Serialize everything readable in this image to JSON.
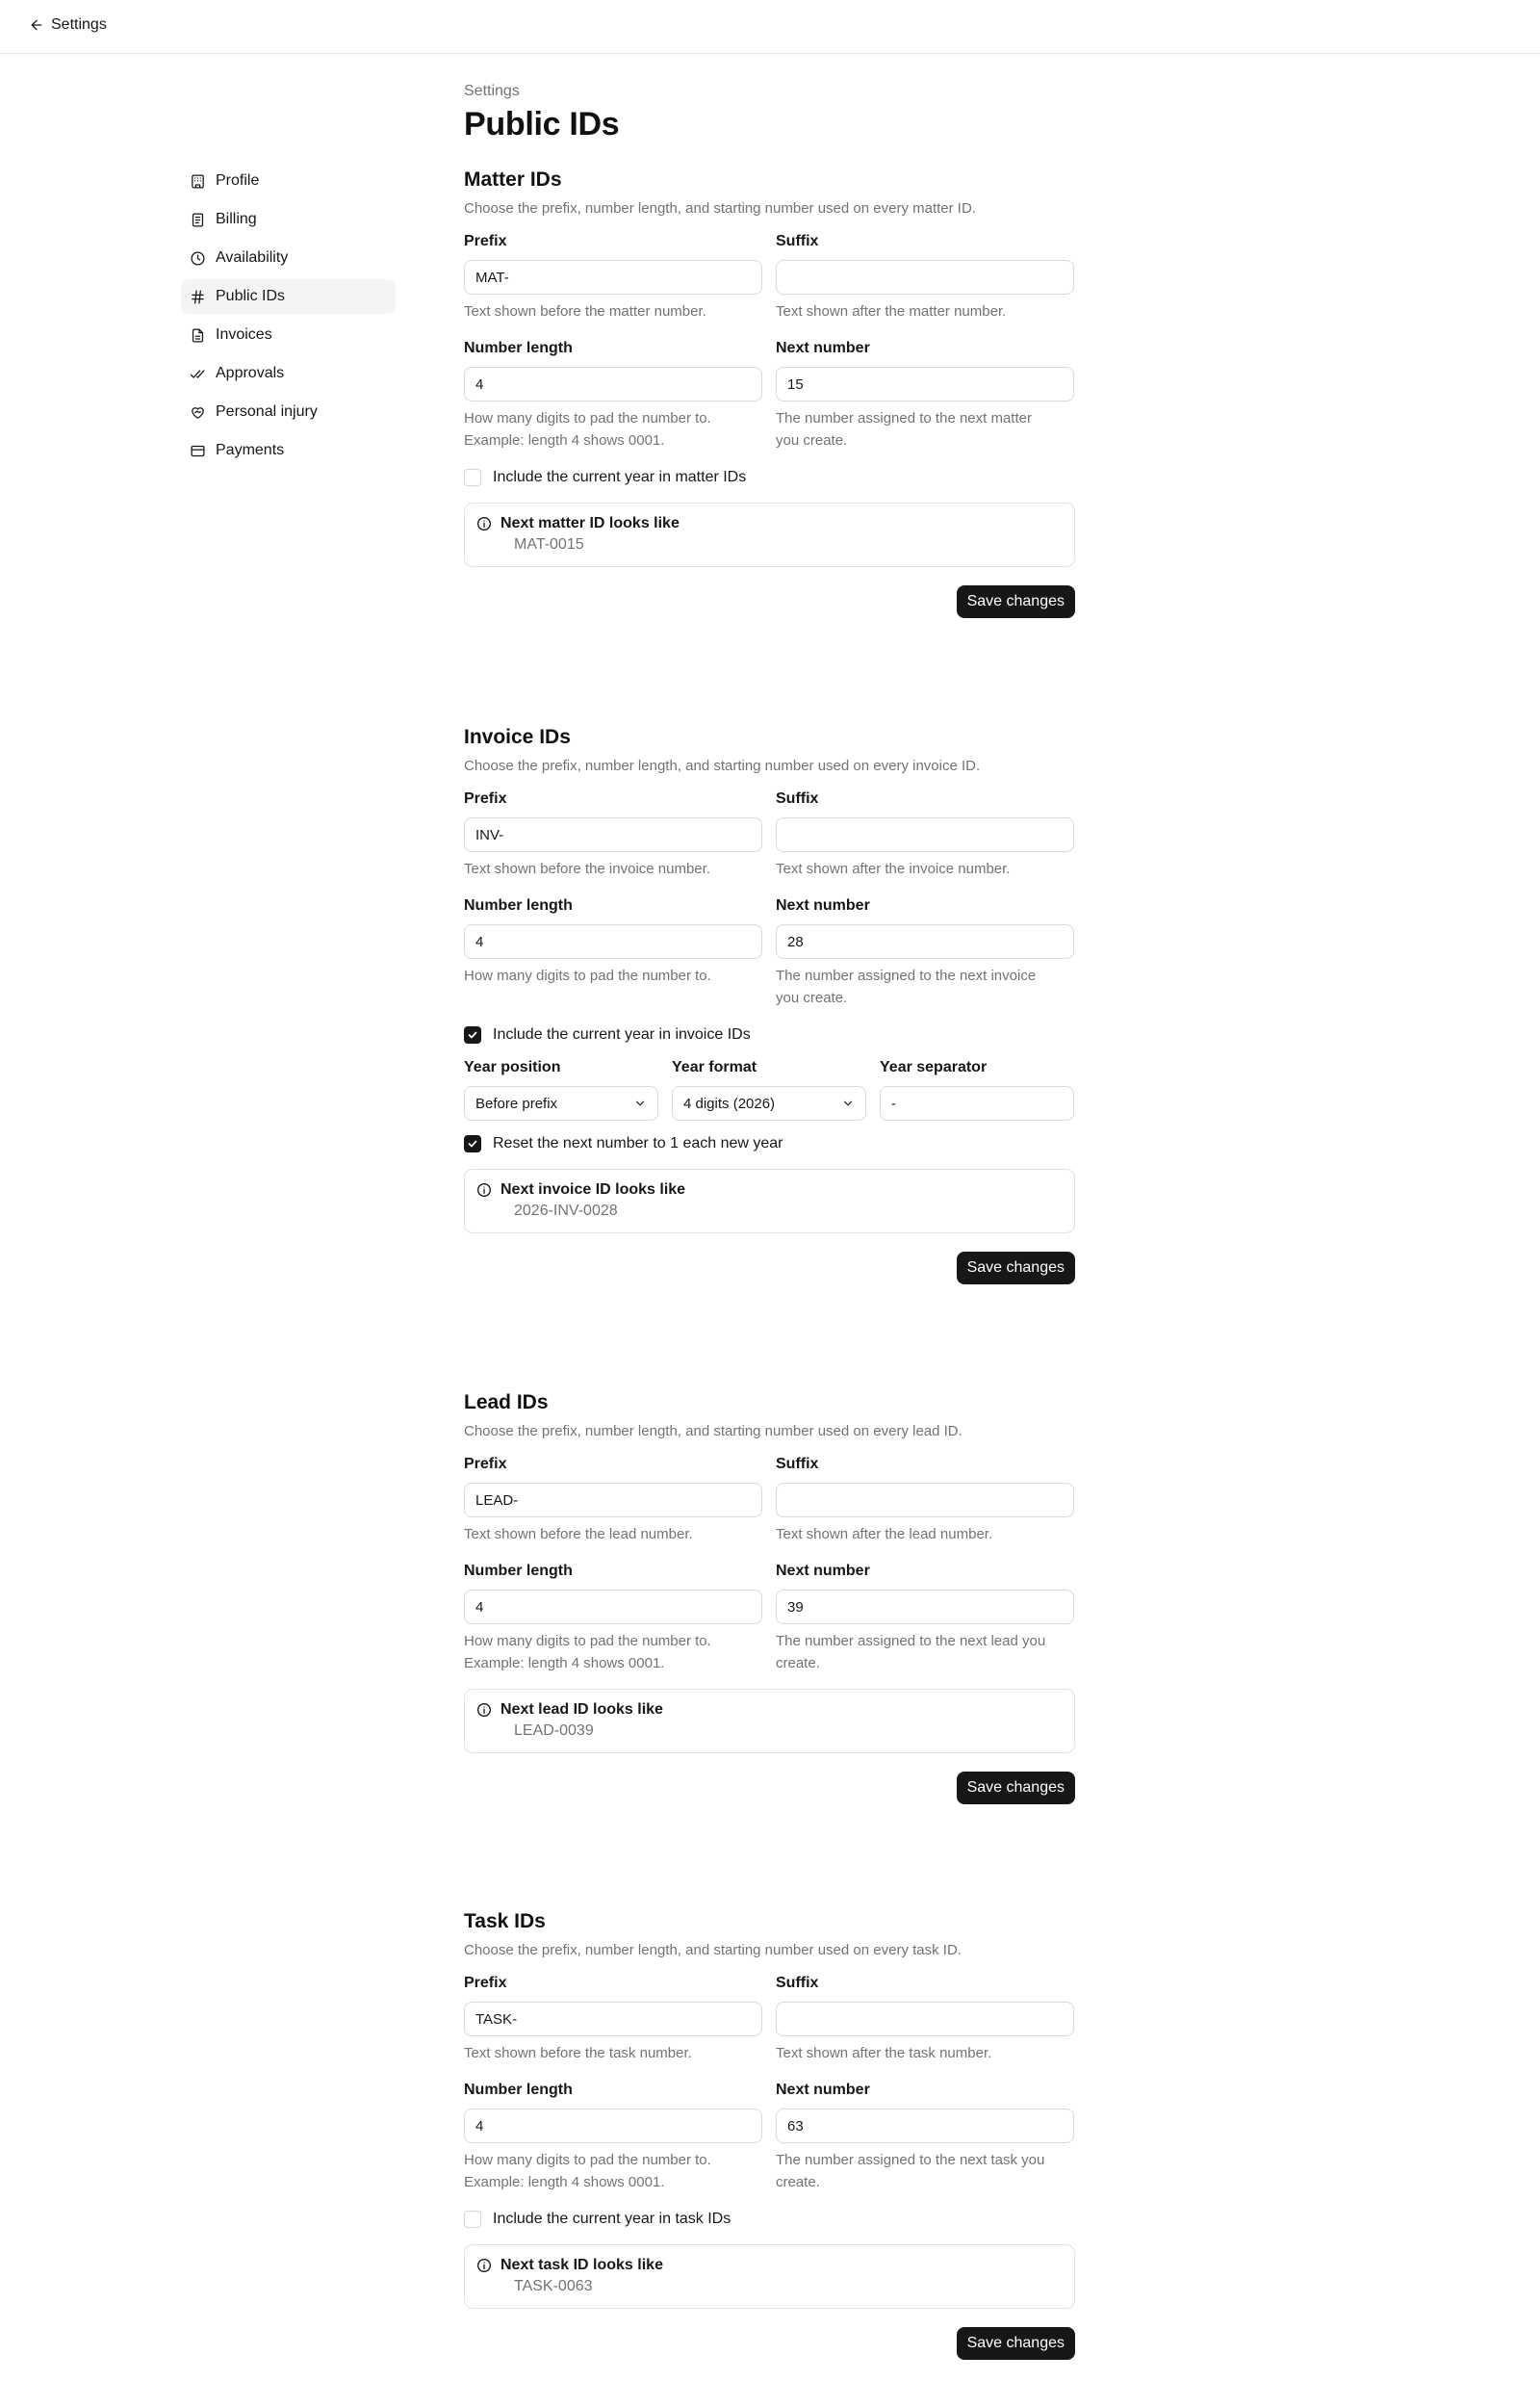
{
  "header": {
    "back_label": "Settings"
  },
  "nav": {
    "items": [
      {
        "label": "Profile",
        "icon": "building-icon"
      },
      {
        "label": "Billing",
        "icon": "receipt-icon"
      },
      {
        "label": "Availability",
        "icon": "clock-icon"
      },
      {
        "label": "Public IDs",
        "icon": "hash-icon",
        "active": true
      },
      {
        "label": "Invoices",
        "icon": "file-text-icon"
      },
      {
        "label": "Approvals",
        "icon": "check-check-icon"
      },
      {
        "label": "Personal injury",
        "icon": "heart-handshake-icon"
      },
      {
        "label": "Payments",
        "icon": "credit-card-icon"
      }
    ]
  },
  "page": {
    "breadcrumb": "Settings",
    "title": "Public IDs"
  },
  "labels": {
    "prefix": "Prefix",
    "suffix": "Suffix",
    "number_length": "Number length",
    "next_number": "Next number",
    "save": "Save changes",
    "year_position": "Year position",
    "year_format": "Year format",
    "year_separator": "Year separator"
  },
  "sections": [
    {
      "title": "Matter IDs",
      "description": "Choose the prefix, number length, and starting number used on every matter ID.",
      "prefix": "MAT-",
      "suffix": "",
      "prefix_hint": "Text shown before the matter number.",
      "suffix_hint": "Text shown after the matter number.",
      "number_length": "4",
      "next_number": "15",
      "length_hint_1": "How many digits to pad the number to.",
      "length_hint_2": "Example: length 4 shows 0001.",
      "next_hint_1": "The number assigned to the next matter",
      "next_hint_2": "you create.",
      "include_year_label": "Include the current year in matter IDs",
      "include_year": false,
      "preview_title": "Next matter ID looks like",
      "preview_value": "MAT-0015"
    },
    {
      "title": "Invoice IDs",
      "description": "Choose the prefix, number length, and starting number used on every invoice ID.",
      "prefix": "INV-",
      "suffix": "",
      "prefix_hint": "Text shown before the invoice number.",
      "suffix_hint": "Text shown after the invoice number.",
      "number_length": "4",
      "next_number": "28",
      "length_hint_1": "How many digits to pad the number to.",
      "next_hint_1": "The number assigned to the next invoice",
      "next_hint_2": "you create.",
      "include_year_label": "Include the current year in invoice IDs",
      "include_year": true,
      "year_position": "Before prefix",
      "year_format": "4 digits (2026)",
      "year_separator": "-",
      "reset_label": "Reset the next number to 1 each new year",
      "reset_yearly": true,
      "preview_title": "Next invoice ID looks like",
      "preview_value": "2026-INV-0028"
    },
    {
      "title": "Lead IDs",
      "description": "Choose the prefix, number length, and starting number used on every lead ID.",
      "prefix": "LEAD-",
      "suffix": "",
      "prefix_hint": "Text shown before the lead number.",
      "suffix_hint": "Text shown after the lead number.",
      "number_length": "4",
      "next_number": "39",
      "length_hint_1": "How many digits to pad the number to.",
      "length_hint_2": "Example: length 4 shows 0001.",
      "next_hint_1": "The number assigned to the next lead you",
      "next_hint_2": "create.",
      "preview_title": "Next lead ID looks like",
      "preview_value": "LEAD-0039"
    },
    {
      "title": "Task IDs",
      "description": "Choose the prefix, number length, and starting number used on every task ID.",
      "prefix": "TASK-",
      "suffix": "",
      "prefix_hint": "Text shown before the task number.",
      "suffix_hint": "Text shown after the task number.",
      "number_length": "4",
      "next_number": "63",
      "length_hint_1": "How many digits to pad the number to.",
      "length_hint_2": "Example: length 4 shows 0001.",
      "next_hint_1": "The number assigned to the next task you",
      "next_hint_2": "create.",
      "include_year_label": "Include the current year in task IDs",
      "include_year": false,
      "preview_title": "Next task ID looks like",
      "preview_value": "TASK-0063"
    }
  ]
}
